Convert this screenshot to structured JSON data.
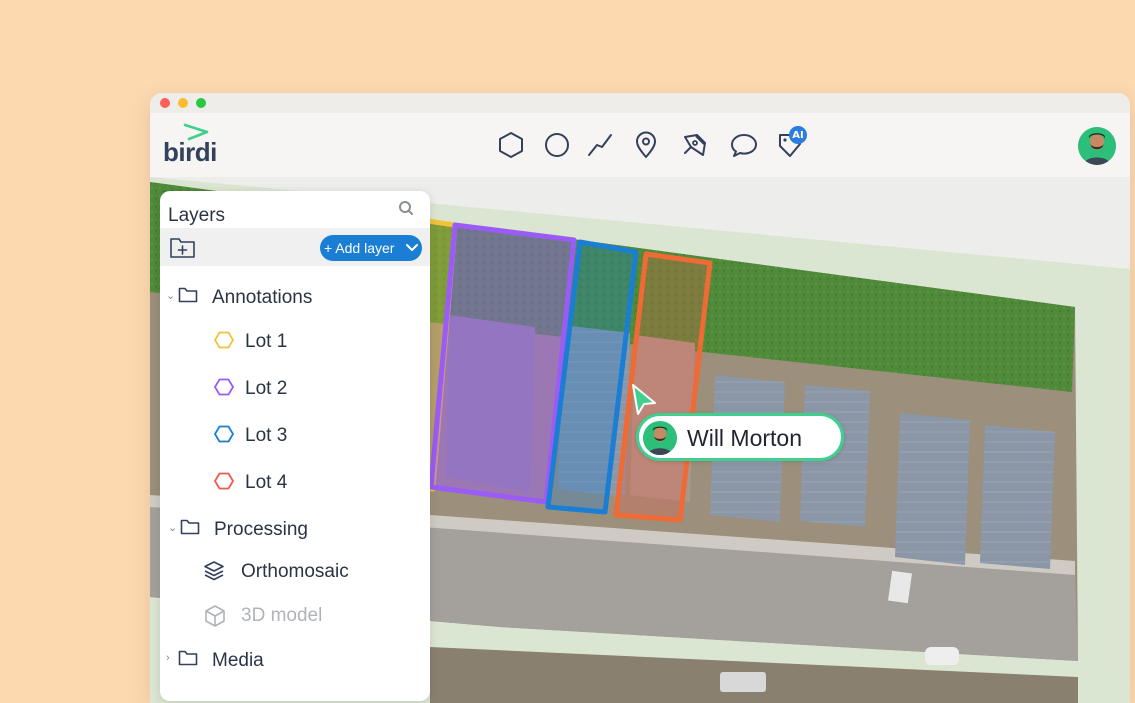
{
  "app": {
    "logo_text": "birdi"
  },
  "toolbar": {
    "tools": [
      {
        "icon": "polygon-icon"
      },
      {
        "icon": "circle-icon"
      },
      {
        "icon": "line-icon"
      },
      {
        "icon": "location-pin-icon"
      },
      {
        "icon": "pen-icon"
      },
      {
        "icon": "comment-icon"
      },
      {
        "icon": "tag-ai-icon"
      }
    ],
    "ai_badge": "AI"
  },
  "layers": {
    "title": "Layers",
    "add_layer_label": "+ Add layer",
    "groups": [
      {
        "label": "Annotations",
        "expanded": true,
        "items": [
          {
            "label": "Lot 1",
            "color": "#f0c43a"
          },
          {
            "label": "Lot 2",
            "color": "#9b5cf6"
          },
          {
            "label": "Lot 3",
            "color": "#1a7fd4"
          },
          {
            "label": "Lot 4",
            "color": "#ef5a4a"
          }
        ]
      },
      {
        "label": "Processing",
        "expanded": true,
        "items": [
          {
            "label": "Orthomosaic",
            "disabled": false
          },
          {
            "label": "3D model",
            "disabled": true
          }
        ]
      },
      {
        "label": "Media",
        "expanded": false,
        "items": []
      }
    ]
  },
  "collaborator": {
    "name": "Will Morton"
  },
  "colors": {
    "background": "#fdd9b0",
    "accent": "#1a7fd4",
    "presence": "#3fcf8e",
    "lot1": "#f0c43a",
    "lot2": "#9b5cf6",
    "lot3": "#1a7fd4",
    "lot4": "#ef5a4a"
  }
}
